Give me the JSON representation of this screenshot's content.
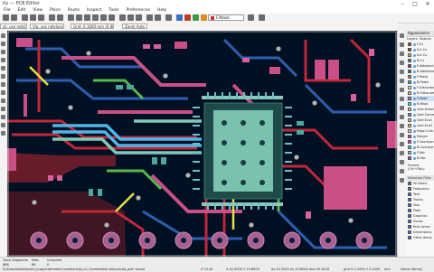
{
  "window": {
    "title": "ity — PCB Editor"
  },
  "menu": [
    "File",
    "Edit",
    "View",
    "Place",
    "Route",
    "Inspect",
    "Tools",
    "Preferences",
    "Help"
  ],
  "toolbar": {
    "active_layer": "F.Mask",
    "active_layer_color": "#c83434"
  },
  "toolbar2": {
    "track": "ck: use netclass width",
    "via": "Via: use netclass sizes",
    "grid": "Grid: 0.1000 mm (0.0039 in)",
    "zoom": "Zoom Auto"
  },
  "appearance": {
    "header": "Appearance",
    "tabs": [
      "Layers",
      "Objects"
    ],
    "layers": [
      {
        "name": "F.Cu",
        "color": "#c83434"
      },
      {
        "name": "In1.Cu",
        "color": "#7f4a1e"
      },
      {
        "name": "In2.Cu",
        "color": "#c2c200"
      },
      {
        "name": "B.Cu",
        "color": "#4d7fc4"
      },
      {
        "name": "F.Adhesive",
        "color": "#8a2b8f"
      },
      {
        "name": "B.Adhesive",
        "color": "#2b6c8f"
      },
      {
        "name": "F.Paste",
        "color": "#b0807f"
      },
      {
        "name": "B.Paste",
        "color": "#00c2c2"
      },
      {
        "name": "F.Silkscreen",
        "color": "#f2edd1"
      },
      {
        "name": "B.Silkscreen",
        "color": "#e8b2a7"
      },
      {
        "name": "F.Mask",
        "color": "#d86498"
      },
      {
        "name": "B.Mask",
        "color": "#02ffee"
      },
      {
        "name": "User.Drawings",
        "color": "#c2c2c2"
      },
      {
        "name": "User.Comments",
        "color": "#5994dc"
      },
      {
        "name": "User.Eco1",
        "color": "#b4dbd2"
      },
      {
        "name": "User.Eco2",
        "color": "#d8c852"
      },
      {
        "name": "Edge.Cuts",
        "color": "#d0d2cd"
      },
      {
        "name": "Margin",
        "color": "#ff26e2"
      },
      {
        "name": "F.Courtyard",
        "color": "#ff26e2"
      },
      {
        "name": "B.Courtyard",
        "color": "#26e9ff"
      },
      {
        "name": "F.Fab",
        "color": "#afafaf"
      },
      {
        "name": "B.Fab",
        "color": "#585dd4"
      }
    ],
    "presets_label": "Presets (Ctrl+Tab):",
    "selection_filter": "Selection Filter",
    "filters": [
      "All items",
      "Footprints",
      "Text",
      "Tracks",
      "Vias",
      "Pads",
      "Graphics",
      "Zones",
      "Rule Areas",
      "Dimensions",
      "Other items"
    ]
  },
  "status": {
    "track_segments_label": "Track Segments",
    "track_segments_value": "868",
    "nets_label": "Nets",
    "nets_value": "89",
    "unrouted_label": "Unrouted",
    "unrouted_value": "0",
    "path": "D:\\Downloads\\board_bugs\\icebreaker-hardware\\ity-v1.1\\icebreaker-bitsy.kicad_pcb' saved.",
    "zoom": "Z 15.44",
    "xy": "X 42.5000  Y 15.8000",
    "dxy": "dx 42.5000  dy 15.8000  dist 45.3418",
    "grid": "grid X 0.1000  Y 0.1000",
    "units": "mm",
    "mode": "Select item(s)"
  }
}
